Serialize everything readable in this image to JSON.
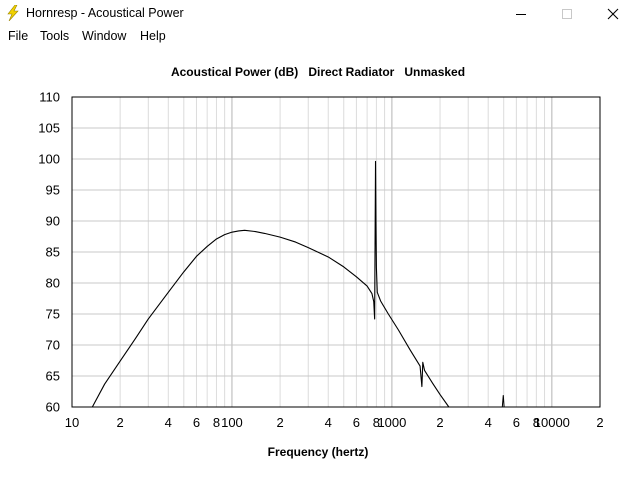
{
  "window": {
    "title": "Hornresp - Acoustical Power",
    "controls": [
      "minimize",
      "maximize",
      "close"
    ]
  },
  "menu": {
    "items": [
      "File",
      "Tools",
      "Window",
      "Help"
    ]
  },
  "chart_data": {
    "type": "line",
    "title_parts": [
      "Acoustical Power (dB)",
      "Direct Radiator",
      "Unmasked"
    ],
    "xlabel": "Frequency (hertz)",
    "ylabel": "",
    "x_scale": "log",
    "xlim": [
      10,
      20000
    ],
    "ylim": [
      60,
      110
    ],
    "grid": true,
    "y_ticks": [
      "110",
      "105",
      "100",
      "95",
      "90",
      "85",
      "80",
      "75",
      "70",
      "65",
      "60"
    ],
    "x_tick_labels": [
      {
        "x": 10,
        "label": "10"
      },
      {
        "x": 20,
        "label": "2"
      },
      {
        "x": 40,
        "label": "4"
      },
      {
        "x": 60,
        "label": "6"
      },
      {
        "x": 80,
        "label": "8"
      },
      {
        "x": 100,
        "label": "100"
      },
      {
        "x": 200,
        "label": "2"
      },
      {
        "x": 400,
        "label": "4"
      },
      {
        "x": 600,
        "label": "6"
      },
      {
        "x": 800,
        "label": "8"
      },
      {
        "x": 1000,
        "label": "1000"
      },
      {
        "x": 2000,
        "label": "2"
      },
      {
        "x": 4000,
        "label": "4"
      },
      {
        "x": 6000,
        "label": "6"
      },
      {
        "x": 8000,
        "label": "8"
      },
      {
        "x": 10000,
        "label": "10000"
      },
      {
        "x": 20000,
        "label": "2"
      }
    ],
    "series": [
      {
        "color": "#000000",
        "points": [
          [
            13.4,
            60
          ],
          [
            16,
            63.7
          ],
          [
            20,
            67.4
          ],
          [
            25,
            71.1
          ],
          [
            30,
            74.2
          ],
          [
            40,
            78.5
          ],
          [
            50,
            81.8
          ],
          [
            60,
            84.3
          ],
          [
            70,
            85.9
          ],
          [
            80,
            87.1
          ],
          [
            90,
            87.8
          ],
          [
            100,
            88.2
          ],
          [
            110,
            88.4
          ],
          [
            120,
            88.5
          ],
          [
            140,
            88.3
          ],
          [
            160,
            88
          ],
          [
            200,
            87.4
          ],
          [
            250,
            86.6
          ],
          [
            300,
            85.7
          ],
          [
            400,
            84.2
          ],
          [
            500,
            82.6
          ],
          [
            600,
            81
          ],
          [
            700,
            79.5
          ],
          [
            750,
            78.3
          ],
          [
            770,
            77
          ],
          [
            780,
            74.2
          ],
          [
            785,
            87
          ],
          [
            790,
            99.6
          ],
          [
            795,
            89.6
          ],
          [
            800,
            82.5
          ],
          [
            810,
            78.5
          ],
          [
            850,
            77.1
          ],
          [
            950,
            75
          ],
          [
            1100,
            72.4
          ],
          [
            1300,
            69.2
          ],
          [
            1500,
            66.6
          ],
          [
            1540,
            63.3
          ],
          [
            1560,
            67.2
          ],
          [
            1600,
            65.9
          ],
          [
            1800,
            63.8
          ],
          [
            2000,
            62
          ],
          [
            2270,
            60
          ]
        ]
      }
    ],
    "artifacts": [
      {
        "points": [
          [
            4900,
            60
          ],
          [
            4970,
            61.9
          ],
          [
            5030,
            60
          ]
        ]
      }
    ]
  }
}
